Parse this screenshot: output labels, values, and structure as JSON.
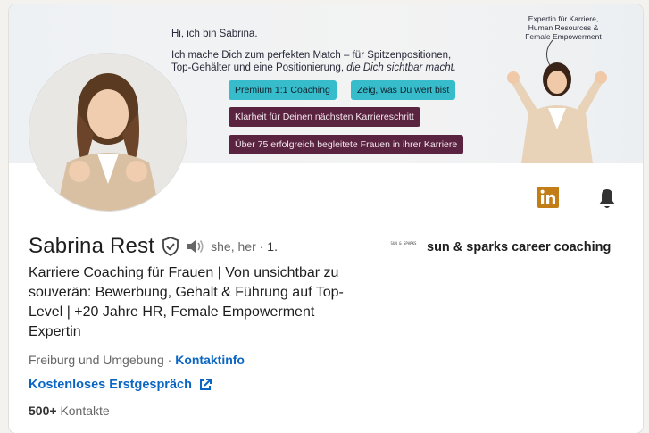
{
  "banner": {
    "greeting": "Hi, ich bin Sabrina.",
    "line1": "Ich mache Dich zum perfekten Match – für Spitzenpositionen,",
    "line2_plain": "Top-Gehälter und eine Positionierung,",
    "line2_italic": "die Dich sichtbar macht.",
    "pills": [
      "Premium 1:1 Coaching",
      "Zeig, was Du wert bist",
      "Klarheit für Deinen nächsten Karriereschritt",
      "Über 75 erfolgreich begleitete Frauen in ihrer Karriere"
    ],
    "tagline": [
      "Expertin für Karriere,",
      "Human Resources &",
      "Female Empowerment"
    ]
  },
  "profile": {
    "name": "Sabrina Rest",
    "pronouns": "she, her",
    "degree": "· 1.",
    "headline": "Karriere Coaching für Frauen | Von unsichtbar zu souverän: Bewerbung, Gehalt & Führung auf Top-Level | +20 Jahre HR, Female Empowerment Expertin",
    "location": "Freiburg und Umgebung",
    "location_sep": "·",
    "contact_info": "Kontaktinfo",
    "website": "Kostenloses Erstgespräch",
    "connections_count": "500+",
    "connections_label": "Kontakte"
  },
  "company": {
    "logo_text": "SUN & SPARKS",
    "name": "sun & sparks career coaching"
  },
  "icons": {
    "linkedin": "linkedin-icon",
    "bell": "bell-icon",
    "verified": "verified-shield-icon",
    "speaker": "speaker-icon",
    "external": "external-link-icon"
  },
  "colors": {
    "link": "#0a66c2",
    "linkedin_badge": "#c37d16",
    "pill_teal": "#37bccb",
    "pill_plum": "#5a2440"
  }
}
